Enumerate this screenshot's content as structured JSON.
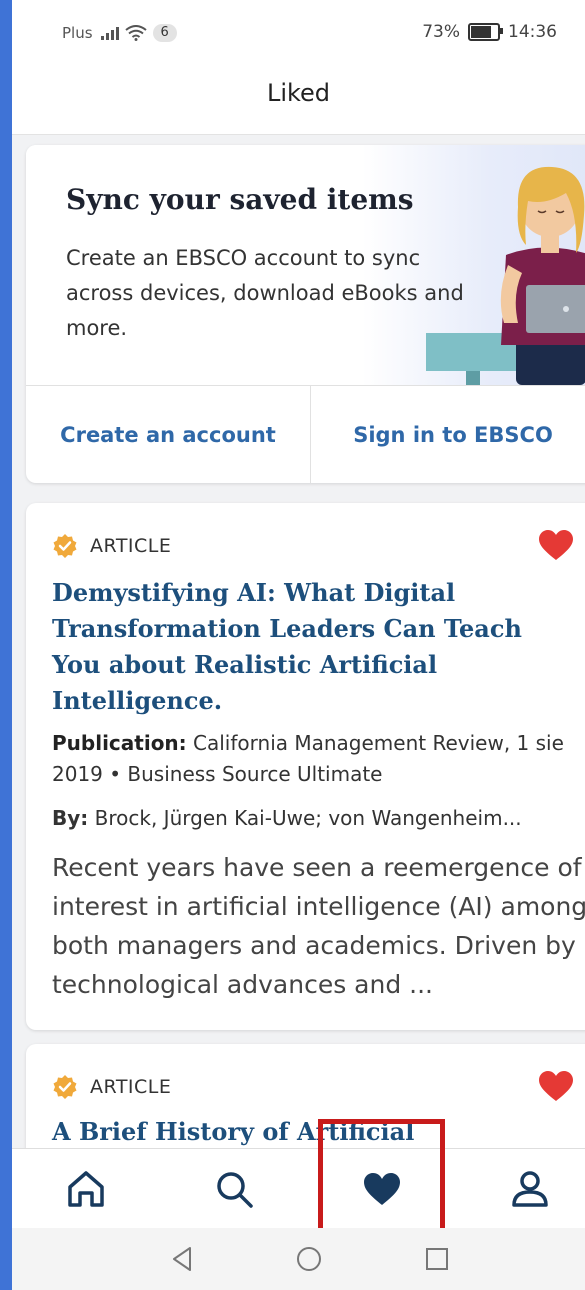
{
  "status_bar": {
    "carrier": "Plus",
    "notification_count": "6",
    "battery_percent": "73%",
    "time": "14:36"
  },
  "header": {
    "title": "Liked"
  },
  "sync_card": {
    "title": "Sync your saved items",
    "body": "Create an EBSCO account to sync across devices, download eBooks and more.",
    "create_account_label": "Create an account",
    "sign_in_label": "Sign in to EBSCO"
  },
  "articles": [
    {
      "type": "ARTICLE",
      "title": "Demystifying AI: What Digital Transformation Leaders Can Teach You about Realistic Artificial Intelligence.",
      "publication_label": "Publication:",
      "publication_value": "California Management Review, 1 sie 2019 • Business Source Ultimate",
      "authors_label": "By:",
      "authors_value": "Brock, Jürgen Kai-Uwe; von Wangenheim...",
      "abstract": "Recent years have seen a reemergence of interest in artificial intelligence (AI) among both managers and academics. Driven by technological advances and ...",
      "liked": true
    },
    {
      "type": "ARTICLE",
      "title": "A Brief History of Artificial",
      "liked": true
    }
  ],
  "bottom_nav": {
    "items": [
      "home-icon",
      "search-icon",
      "heart-icon",
      "account-icon"
    ],
    "active": "heart-icon"
  },
  "colors": {
    "accent": "#2f68a8",
    "title_blue": "#1d4f7c",
    "heart_red": "#e53935",
    "badge_orange": "#f0a93b",
    "highlight": "#c81b1b",
    "nav_dark": "#183a5e"
  }
}
